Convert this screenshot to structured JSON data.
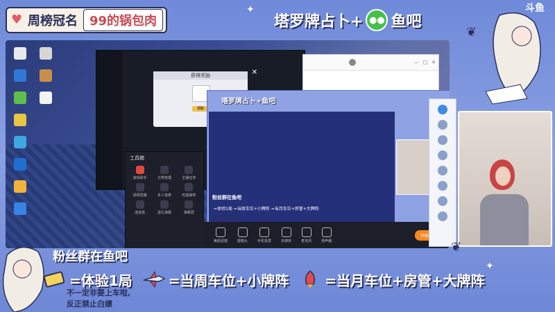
{
  "banner": {
    "title_prefix": "周榜冠名",
    "title_name": "99的锅包肉",
    "right_text_1": "塔罗牌占卜+",
    "right_text_2": "鱼吧"
  },
  "logo_text": "斗鱼",
  "screen": {
    "popup_title": "获得奖励",
    "popup_button": "领取",
    "game_button": "开始",
    "stream_title_mini": "塔罗牌占卜+",
    "stream_title_mini_2": "鱼吧",
    "fans_mini": "粉丝群在鱼吧",
    "rules_mini": "=体验1局   =当周车位+小牌阵   =当月车位+房管+大牌阵",
    "rules_mini_note": "反正禁止白嫖",
    "menu_title": "工具箱",
    "menu_items": [
      "游戏助手",
      "分类管理",
      "主播任务",
      "视频直播",
      "多人连麦",
      "轮盘抽奖",
      "连连看",
      "送礼弹幕",
      "弹幕屏"
    ],
    "toolbar_items": [
      "美颜滤镜",
      "摄像头",
      "手机投屏",
      "多媒体",
      "麦克风",
      "扬声器"
    ],
    "start_live": "开始直播"
  },
  "bottom": {
    "fans_title": "粉丝群在鱼吧",
    "rules": [
      {
        "icon": "ticket-icon",
        "text": "=体验1局"
      },
      {
        "icon": "rocket-plane-icon",
        "text": "=当周车位+小牌阵"
      },
      {
        "icon": "rocket-icon",
        "text": "=当月车位+房管+大牌阵"
      }
    ],
    "note_1": "不一定非要上车啦,",
    "note_2": "反正禁止白嫖"
  },
  "colors": {
    "frame": "#7f97dd",
    "outline": "#2a2f5a",
    "accent_red": "#c94a52",
    "wechat_green": "#45c045",
    "live_orange": "#f48b1f"
  }
}
